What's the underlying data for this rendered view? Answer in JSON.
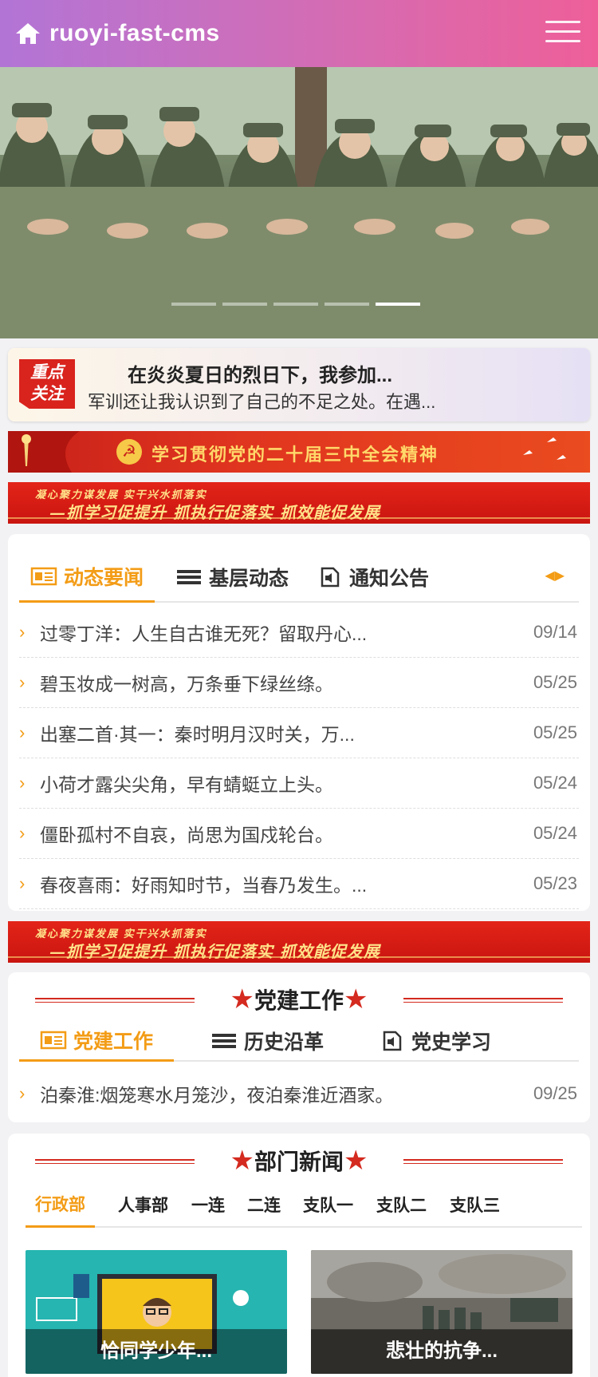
{
  "header": {
    "title": "ruoyi-fast-cms",
    "home_icon": "home-icon",
    "menu_icon": "hamburger-menu-icon"
  },
  "hero": {
    "slide_count": 5,
    "active_slide": 5
  },
  "featured": {
    "badge_line1": "重点",
    "badge_line2": "关注",
    "title": "在炎炎夏日的烈日下，我参加...",
    "summary": "军训还让我认识到了自己的不足之处。在遇..."
  },
  "banners": {
    "party_spirit": "学习贯彻党的二十届三中全会精神",
    "slogan_top": "凝心聚力谋发展    实干兴水抓落实",
    "slogan_bottom": "—抓学习促提升  抓执行促落实  抓效能促发展"
  },
  "news": {
    "tabs": [
      {
        "label": "动态要闻",
        "icon": "newspaper-icon"
      },
      {
        "label": "基层动态",
        "icon": "list-icon"
      },
      {
        "label": "通知公告",
        "icon": "announcement-icon"
      }
    ],
    "arrows": "◀▶",
    "items": [
      {
        "title": "过零丁洋：人生自古谁无死？留取丹心...",
        "date": "09/14"
      },
      {
        "title": "碧玉妆成一树高，万条垂下绿丝绦。",
        "date": "05/25"
      },
      {
        "title": "出塞二首·其一：秦时明月汉时关，万...",
        "date": "05/25"
      },
      {
        "title": "小荷才露尖尖角，早有蜻蜓立上头。",
        "date": "05/24"
      },
      {
        "title": "僵卧孤村不自哀，尚思为国戍轮台。",
        "date": "05/24"
      },
      {
        "title": "春夜喜雨：好雨知时节，当春乃发生。...",
        "date": "05/23"
      }
    ]
  },
  "party": {
    "heading": "党建工作",
    "tabs": [
      {
        "label": "党建工作",
        "icon": "newspaper-icon"
      },
      {
        "label": "历史沿革",
        "icon": "list-icon"
      },
      {
        "label": "党史学习",
        "icon": "announcement-icon"
      }
    ],
    "items": [
      {
        "title": "泊秦淮:烟笼寒水月笼沙，夜泊秦淮近酒家。",
        "date": "09/25"
      }
    ]
  },
  "dept": {
    "heading": "部门新闻",
    "tabs": [
      "行政部",
      "人事部",
      "一连",
      "二连",
      "支队一",
      "支队二",
      "支队三"
    ],
    "cards": [
      {
        "caption": "恰同学少年..."
      },
      {
        "caption": "悲壮的抗争..."
      }
    ]
  },
  "colors": {
    "accent": "#f39c16",
    "party_red": "#d42a1f",
    "header_start": "#b275d6",
    "header_end": "#ee5f99"
  }
}
